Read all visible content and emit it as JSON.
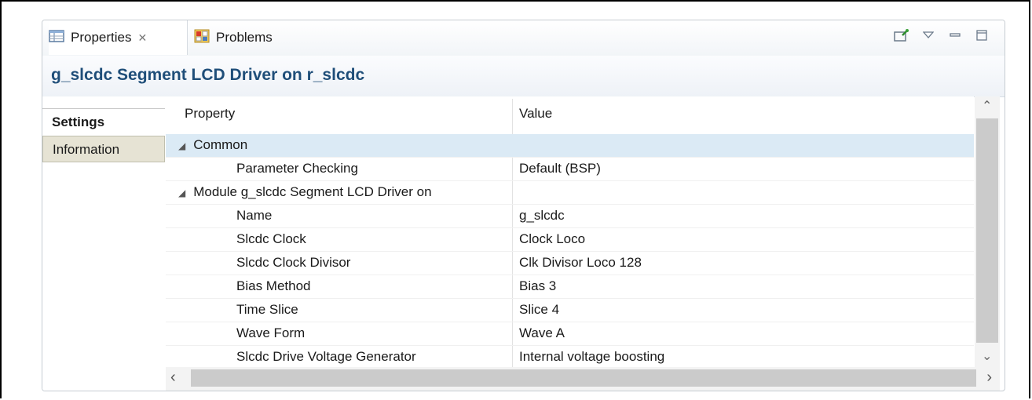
{
  "tabs": {
    "properties_label": "Properties",
    "problems_label": "Problems"
  },
  "header": {
    "title": "g_slcdc Segment LCD Driver on r_slcdc"
  },
  "side_tabs": {
    "settings": "Settings",
    "information": "Information"
  },
  "table": {
    "col_property": "Property",
    "col_value": "Value",
    "rows": [
      {
        "property": "Common",
        "value": ""
      },
      {
        "property": "Parameter Checking",
        "value": "Default (BSP)"
      },
      {
        "property": "Module g_slcdc Segment LCD Driver on",
        "value": ""
      },
      {
        "property": "Name",
        "value": "g_slcdc"
      },
      {
        "property": "Slcdc Clock",
        "value": "Clock Loco"
      },
      {
        "property": "Slcdc Clock Divisor",
        "value": "Clk Divisor Loco 128"
      },
      {
        "property": "Bias Method",
        "value": "Bias 3"
      },
      {
        "property": "Time Slice",
        "value": "Slice 4"
      },
      {
        "property": "Wave Form",
        "value": "Wave A"
      },
      {
        "property": "Slcdc Drive Voltage Generator",
        "value": "Internal voltage boosting"
      }
    ]
  },
  "colors": {
    "title": "#1f4e79",
    "selected_row": "#dbeaf5",
    "information_tab": "#e6e3d4"
  }
}
